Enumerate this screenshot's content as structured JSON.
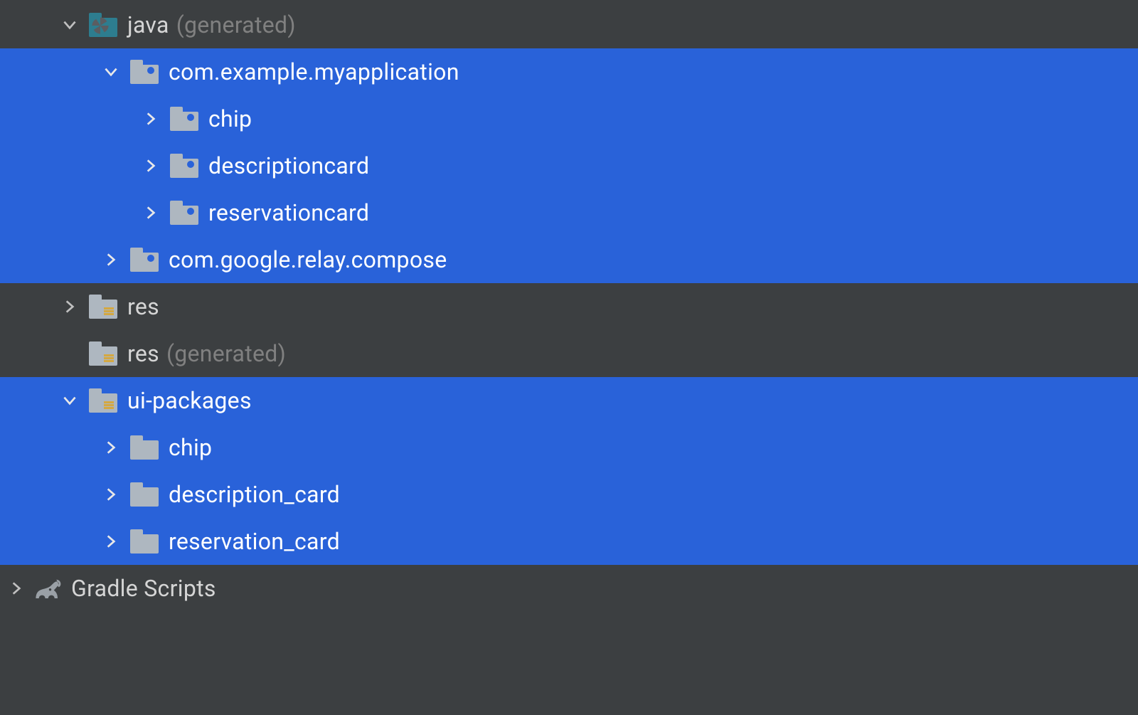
{
  "tree": {
    "java_generated": {
      "label": "java",
      "annotation": "(generated)",
      "indent": 85,
      "expanded": true,
      "selected": false,
      "icon": "folder-teal-pinwheel"
    },
    "com_example_myapplication": {
      "label": "com.example.myapplication",
      "indent": 143,
      "expanded": true,
      "selected": true,
      "icon": "folder-package"
    },
    "chip": {
      "label": "chip",
      "indent": 199,
      "expanded": false,
      "selected": true,
      "icon": "folder-package"
    },
    "descriptioncard": {
      "label": "descriptioncard",
      "indent": 199,
      "expanded": false,
      "selected": true,
      "icon": "folder-package"
    },
    "reservationcard": {
      "label": "reservationcard",
      "indent": 199,
      "expanded": false,
      "selected": true,
      "icon": "folder-package"
    },
    "com_google_relay_compose": {
      "label": "com.google.relay.compose",
      "indent": 143,
      "expanded": false,
      "selected": true,
      "icon": "folder-package"
    },
    "res": {
      "label": "res",
      "indent": 85,
      "expanded": false,
      "selected": false,
      "icon": "folder-resource"
    },
    "res_generated": {
      "label": "res",
      "annotation": "(generated)",
      "indent": 85,
      "no_arrow": true,
      "selected": false,
      "icon": "folder-resource"
    },
    "ui_packages": {
      "label": "ui-packages",
      "indent": 85,
      "expanded": true,
      "selected": true,
      "icon": "folder-resource"
    },
    "chip2": {
      "label": "chip",
      "indent": 143,
      "expanded": false,
      "selected": true,
      "icon": "folder-plain"
    },
    "description_card": {
      "label": "description_card",
      "indent": 143,
      "expanded": false,
      "selected": true,
      "icon": "folder-plain"
    },
    "reservation_card": {
      "label": "reservation_card",
      "indent": 143,
      "expanded": false,
      "selected": true,
      "icon": "folder-plain"
    },
    "gradle_scripts": {
      "label": "Gradle Scripts",
      "indent": 10,
      "expanded": false,
      "selected": false,
      "icon": "gradle"
    }
  },
  "colors": {
    "background": "#3c3f41",
    "selection": "#2962d9",
    "text": "#d5d5d5",
    "text_muted": "#808080",
    "folder": "#aeb7c0",
    "folder_teal": "#2d7d8f",
    "resource_accent": "#d4a842"
  }
}
